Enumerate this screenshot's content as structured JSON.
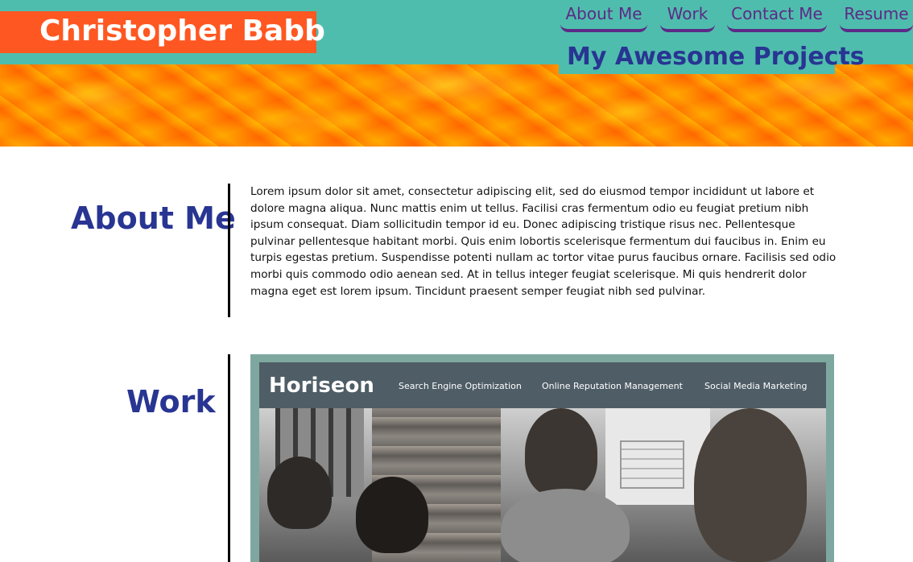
{
  "header": {
    "brand": "Christopher Babb",
    "nav": [
      {
        "label": "About Me"
      },
      {
        "label": "Work"
      },
      {
        "label": "Contact Me"
      },
      {
        "label": "Resume"
      }
    ]
  },
  "hero": {
    "title": "My Awesome Projects"
  },
  "about": {
    "heading": "About Me",
    "text": "Lorem ipsum dolor sit amet, consectetur adipiscing elit, sed do eiusmod tempor incididunt ut labore et dolore magna aliqua. Nunc mattis enim ut tellus. Facilisi cras fermentum odio eu feugiat pretium nibh ipsum consequat. Diam sollicitudin tempor id eu. Donec adipiscing tristique risus nec. Pellentesque pulvinar pellentesque habitant morbi. Quis enim lobortis scelerisque fermentum dui faucibus in. Enim eu turpis egestas pretium. Suspendisse potenti nullam ac tortor vitae purus faucibus ornare. Facilisis sed odio morbi quis commodo odio aenean sed. At in tellus integer feugiat scelerisque. Mi quis hendrerit dolor magna eget est lorem ipsum. Tincidunt praesent semper feugiat nibh sed pulvinar."
  },
  "work": {
    "heading": "Work",
    "project": {
      "logo": "Horiseon",
      "links": [
        "Search Engine Optimization",
        "Online Reputation Management",
        "Social Media Marketing"
      ]
    }
  },
  "colors": {
    "header_bg": "#4fbdad",
    "brand_bg": "#ff5722",
    "nav_text": "#5c2a86",
    "heading_text": "#283592",
    "hero_orange": "#ff8c00"
  }
}
